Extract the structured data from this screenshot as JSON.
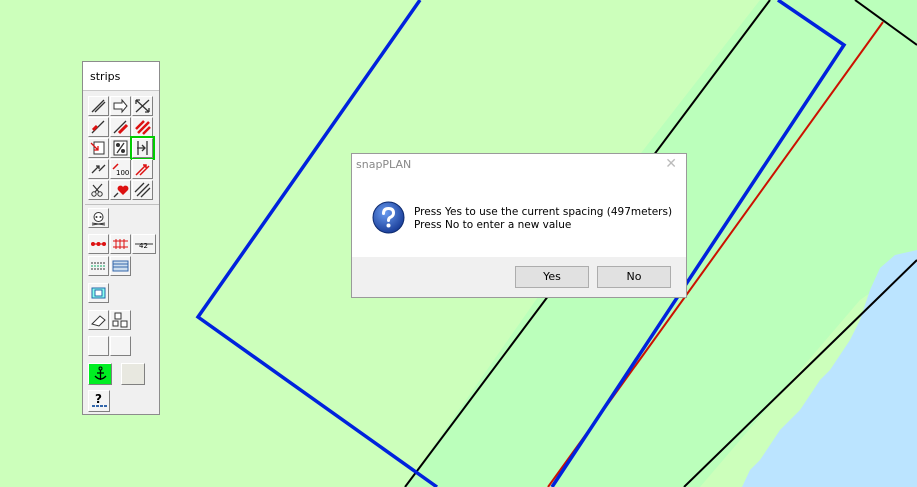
{
  "toolbox": {
    "title": "strips",
    "counter_label": "100",
    "ruler_label": "42",
    "help_label": "?"
  },
  "dialog": {
    "title": "snapPLAN",
    "close_glyph": "✕",
    "message_line1": "Press Yes to use the current spacing (497meters)",
    "message_line2": "Press No to enter a new value",
    "yes_label": "Yes",
    "no_label": "No"
  },
  "colors": {
    "land": "#ccffbb",
    "strip_fill": "#bbffbb",
    "water": "#bbe4ff",
    "blue_outline": "#0022dd",
    "red_line": "#cc1100"
  }
}
